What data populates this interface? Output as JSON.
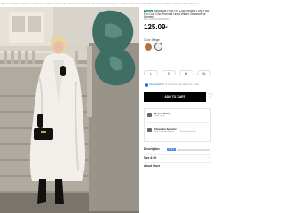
{
  "breadcrumb": "Women Clothing / Women Outerwear / Women Faux Fur Coats / Jumpsuits Faux Fur Coat Elegant Long Faux Fur Coat Chic Thermal Lined Winter Outwear For Women",
  "product": {
    "badge": "Trends",
    "title": "Jumpsuits Faux Fur Coat Elegant Long Faux Fur Coat Chic Thermal Lined Winter Outwear For Women",
    "sku": "SKU: s2304161695938471",
    "price": "125.09",
    "currency": "€",
    "color_label": "Color:",
    "color_value": "Beige"
  },
  "sizes": [
    "L",
    "S",
    "M",
    "XL"
  ],
  "size_guide": {
    "label": "Size Guide",
    "fit": "98% of customers say fit is true to size"
  },
  "actions": {
    "add_to_cart": "ADD TO CART"
  },
  "policies": {
    "return_title": "Return Policy",
    "return_sub": "Learn more",
    "shipping_title": "Shopping Security",
    "shipping_items": [
      "Safe Payment Options",
      "Privacy Protection"
    ]
  },
  "sections": {
    "description": "Description",
    "description_badge": "Quick",
    "size_fit": "Size & Fit",
    "about_store": "About Store"
  },
  "colors": {
    "accent": "#0b8d5b",
    "link": "#1f6fd6",
    "swatch_brown": "#b8713c",
    "swatch_beige": "#f3efea"
  }
}
